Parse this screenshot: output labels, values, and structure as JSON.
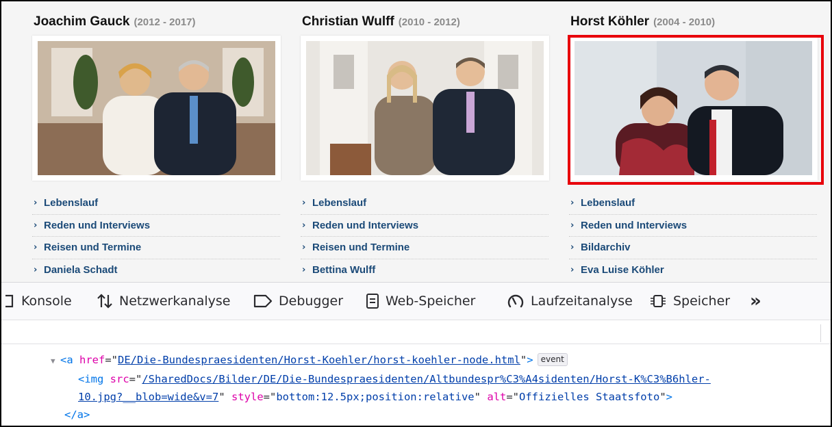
{
  "presidents": [
    {
      "name": "Joachim Gauck",
      "years": "(2012 - 2017)",
      "links": [
        "Lebenslauf",
        "Reden und Interviews",
        "Reisen und Termine",
        "Daniela Schadt"
      ]
    },
    {
      "name": "Christian Wulff",
      "years": "(2010 - 2012)",
      "links": [
        "Lebenslauf",
        "Reden und Interviews",
        "Reisen und Termine",
        "Bettina Wulff"
      ]
    },
    {
      "name": "Horst Köhler",
      "years": "(2004 - 2010)",
      "links": [
        "Lebenslauf",
        "Reden und Interviews",
        "Bildarchiv",
        "Eva Luise Köhler"
      ]
    }
  ],
  "devtools": {
    "tabs": [
      "Konsole",
      "Netzwerkanalyse",
      "Debugger",
      "Web-Speicher",
      "Laufzeitanalyse",
      "Speicher"
    ],
    "more_label": "»"
  },
  "markup": {
    "a_open": "<a",
    "a_attr": "href",
    "a_href": "DE/Die-Bundespraesidenten/Horst-Koehler/horst-koehler-node.html",
    "event_badge": "event",
    "img_open": "<img",
    "img_src_attr": "src",
    "img_src_line1": "/SharedDocs/Bilder/DE/Die-Bundespraesidenten/Altbundespr%C3%A4sidenten/Horst-K%C3%B6hler-",
    "img_src_line2": "10.jpg?__blob=wide&v=7",
    "style_attr": "style",
    "style_val": "bottom:12.5px;position:relative",
    "alt_attr": "alt",
    "alt_val": "Offizielles Staatsfoto",
    "a_close": "</a>"
  },
  "colors": {
    "highlight": "#e8000b",
    "link": "#1b4a78",
    "tag": "#0074e8",
    "attr_name": "#dd00a9",
    "attr_value": "#003eaa"
  }
}
